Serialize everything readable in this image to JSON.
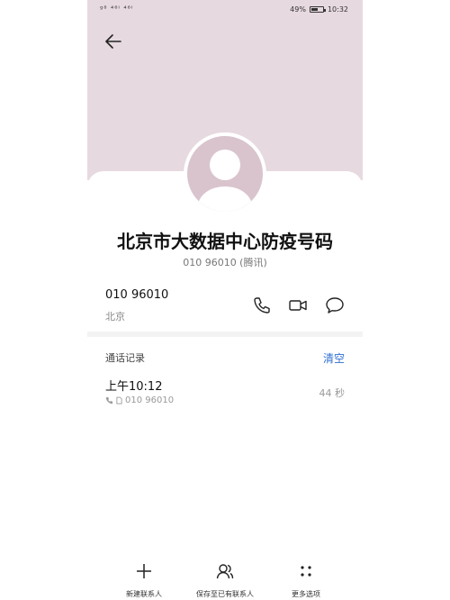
{
  "status_bar": {
    "signal_text": "ᵍ⁸ ⁴⁶ᴵ ⁴⁶ᴵ",
    "battery": "49%",
    "battery_level": 0.49,
    "time": "10:32"
  },
  "contact": {
    "name": "北京市大数据中心防疫号码",
    "subtitle": "010 96010 (腾讯)",
    "number": "010 96010",
    "location": "北京"
  },
  "call_log": {
    "title": "通话记录",
    "clear_label": "清空",
    "records": [
      {
        "time": "上午10:12",
        "number": "010 96010",
        "duration": "44 秒"
      }
    ]
  },
  "bottom_bar": {
    "new_contact": "新建联系人",
    "save_existing": "保存至已有联系人",
    "more_options": "更多选项"
  },
  "colors": {
    "header_bg": "#e7d9e0",
    "avatar_bg": "#d9c4ce",
    "accent": "#2f6fd1"
  }
}
